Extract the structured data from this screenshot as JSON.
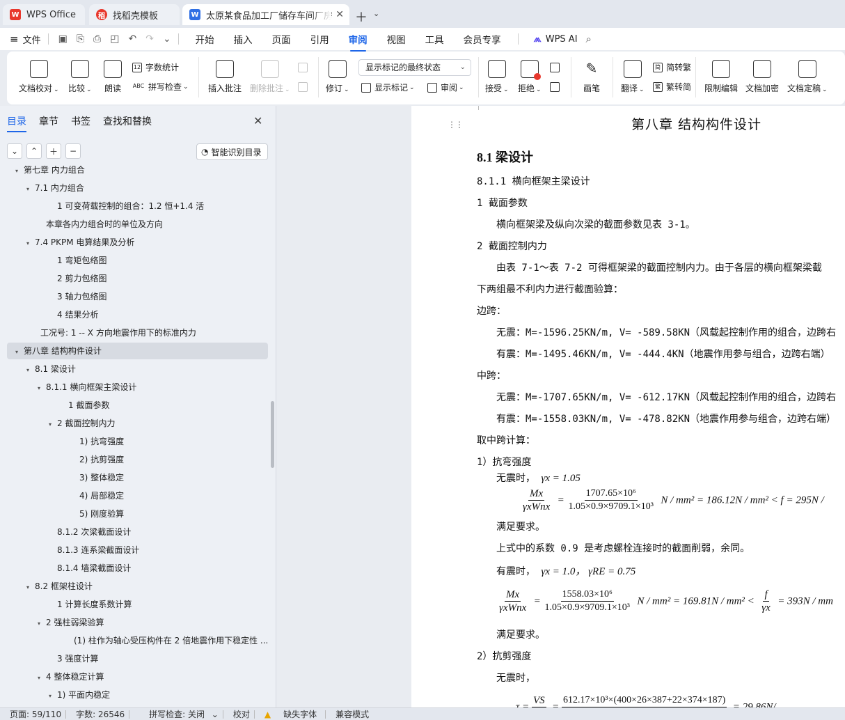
{
  "tabs": [
    {
      "label": "WPS Office",
      "logo": "wps-logo"
    },
    {
      "label": "找稻壳模板",
      "logo": "docer-logo"
    },
    {
      "label": "太原某食品加工厂储存车间厂房",
      "logo": "writer-logo"
    }
  ],
  "menu": {
    "file": "文件",
    "items": [
      "开始",
      "插入",
      "页面",
      "引用",
      "审阅",
      "视图",
      "工具",
      "会员专享"
    ],
    "active": "审阅",
    "ai": "WPS AI"
  },
  "ribbon": {
    "doc_proof": "文档校对",
    "compare": "比较",
    "read_aloud": "朗读",
    "word_count": "字数统计",
    "spell_check": "拼写检查",
    "insert_comment": "插入批注",
    "delete_comment": "删除批注",
    "revise": "修订",
    "markup_dropdown": "显示标记的最终状态",
    "show_markup": "显示标记",
    "review": "审阅",
    "accept": "接受",
    "reject": "拒绝",
    "pen": "画笔",
    "translate": "翻译",
    "to_traditional": "简转繁",
    "to_simplified": "繁转简",
    "restrict_edit": "限制编辑",
    "encrypt": "文档加密",
    "finalize": "文档定稿"
  },
  "nav": {
    "tabs": [
      "目录",
      "章节",
      "书签",
      "查找和替换"
    ],
    "smart_toc": "智能识别目录",
    "toc": [
      {
        "text": "第七章 内力组合",
        "level": 0,
        "tw": "▾"
      },
      {
        "text": "7.1 内力组合",
        "level": 1,
        "tw": "▾"
      },
      {
        "text": "1 可变荷载控制的组合：1.2 恒+1.4 活",
        "level": 3,
        "tw": ""
      },
      {
        "text": "本章各内力组合时的单位及方向",
        "level": 2,
        "tw": ""
      },
      {
        "text": "7.4 PKPM 电算结果及分析",
        "level": 1,
        "tw": "▾"
      },
      {
        "text": "1 弯矩包络图",
        "level": 3,
        "tw": ""
      },
      {
        "text": "2 剪力包络图",
        "level": 3,
        "tw": ""
      },
      {
        "text": "3 轴力包络图",
        "level": 3,
        "tw": ""
      },
      {
        "text": "4 结果分析",
        "level": 3,
        "tw": ""
      },
      {
        "text": "工况号: 1 -- X 方向地震作用下的标准内力",
        "level": 1.5,
        "tw": ""
      },
      {
        "text": "第八章 结构构件设计",
        "level": 0,
        "tw": "▾",
        "selected": true
      },
      {
        "text": "8.1 梁设计",
        "level": 1,
        "tw": "▾"
      },
      {
        "text": "8.1.1 横向框架主梁设计",
        "level": 2,
        "tw": "▾"
      },
      {
        "text": "1 截面参数",
        "level": 4,
        "tw": ""
      },
      {
        "text": "2 截面控制内力",
        "level": 3,
        "tw": "▾"
      },
      {
        "text": "1) 抗弯强度",
        "level": 5,
        "tw": ""
      },
      {
        "text": "2) 抗剪强度",
        "level": 5,
        "tw": ""
      },
      {
        "text": "3) 整体稳定",
        "level": 5,
        "tw": ""
      },
      {
        "text": "4) 局部稳定",
        "level": 5,
        "tw": ""
      },
      {
        "text": "5) 刚度验算",
        "level": 5,
        "tw": ""
      },
      {
        "text": "8.1.2 次梁截面设计",
        "level": 3,
        "tw": ""
      },
      {
        "text": "8.1.3 连系梁截面设计",
        "level": 3,
        "tw": ""
      },
      {
        "text": "8.1.4 墙梁截面设计",
        "level": 3,
        "tw": ""
      },
      {
        "text": "8.2 框架柱设计",
        "level": 1,
        "tw": "▾"
      },
      {
        "text": "1 计算长度系数计算",
        "level": 3,
        "tw": ""
      },
      {
        "text": "2 强柱弱梁验算",
        "level": 2,
        "tw": "▾"
      },
      {
        "text": "(1) 柱作为轴心受压构件在 2 倍地震作用下稳定性 ...",
        "level": 4.5,
        "tw": ""
      },
      {
        "text": "3 强度计算",
        "level": 3,
        "tw": ""
      },
      {
        "text": "4 整体稳定计算",
        "level": 2,
        "tw": "▾"
      },
      {
        "text": "1) 平面内稳定",
        "level": 3,
        "tw": "▾"
      }
    ]
  },
  "doc": {
    "chapter_title": "第八章 结构构件设计",
    "section": "8.1 梁设计",
    "lines": [
      "8.1.1 横向框架主梁设计",
      "1 截面参数",
      "横向框架梁及纵向次梁的截面参数见表 3-1。",
      "2 截面控制内力",
      "由表 7-1～表 7-2 可得框架梁的截面控制内力。由于各层的横向框架梁截",
      "下两组最不利内力进行截面验算：",
      "边跨：",
      "无震：M=-1596.25KN/m, V= -589.58KN（风载起控制作用的组合，边跨右",
      "有震：M=-1495.46KN/m, V= -444.4KN（地震作用参与组合，边跨右端）",
      "中跨：",
      "无震：M=-1707.65KN/m, V= -612.17KN（风载起控制作用的组合，边跨右",
      "有震：M=-1558.03KN/m, V= -478.82KN（地震作用参与组合，边跨右端）",
      "取中跨计算：",
      "1）抗弯强度",
      "无震时，",
      "满足要求。",
      "上式中的系数 0.9 是考虑螺栓连接时的截面削弱，余同。",
      "有震时，",
      "满足要求。",
      "2）抗剪强度",
      "无震时，"
    ],
    "eq1_gamma": "γx = 1.05",
    "eq1_num": "1707.65×10⁶",
    "eq1_den": "1.05×0.9×9709.1×10³",
    "eq1_rhs": "N / mm² = 186.12N / mm² < f = 295N /",
    "eq2_gamma": "γx = 1.0，  γRE = 0.75",
    "eq2_num": "1558.03×10⁶",
    "eq2_den": "1.05×0.9×9709.1×10³",
    "eq2_rhs": "N / mm² = 169.81N / mm² <",
    "eq2_rhs2": "= 393N / mm",
    "eq3_num": "612.17×10³×(400×26×387+22×374×187)",
    "eq3_rhs": "= 29.86N/",
    "frac_lhs_num": "Mx",
    "frac_lhs_den": "γxWnx",
    "frac_f_num": "f",
    "frac_f_den": "γx",
    "eq3_lhs": "VS"
  },
  "status": {
    "page": "页面: 59/110",
    "words": "字数: 26546",
    "spell": "拼写检查: 关闭",
    "proof": "校对",
    "missing_font": "缺失字体",
    "compat": "兼容模式"
  },
  "colors": {
    "accent": "#1e66e8",
    "wps_red": "#e8372c",
    "writer_blue": "#2f6fe4"
  }
}
